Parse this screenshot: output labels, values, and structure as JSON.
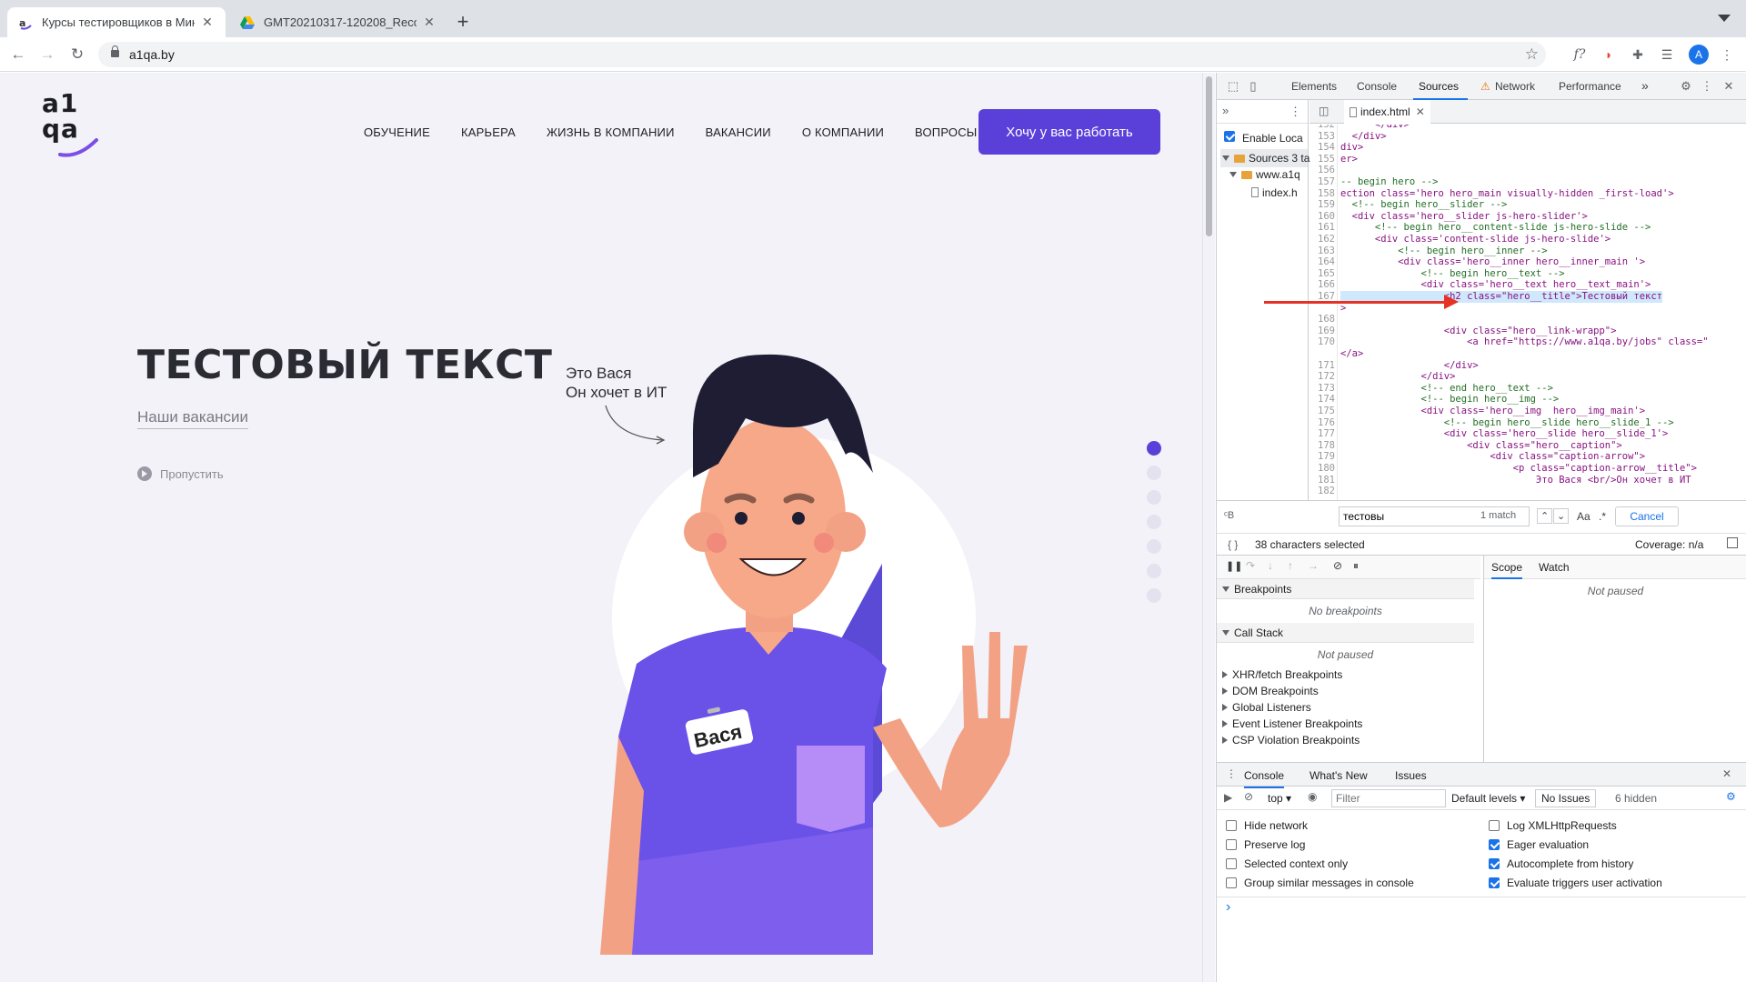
{
  "browser": {
    "tabs": [
      {
        "title": "Курсы тестировщиков в Мин",
        "active": true,
        "icon": "a1qa-favicon"
      },
      {
        "title": "GMT20210317-120208_Recor",
        "active": false,
        "icon": "google-drive-icon"
      }
    ],
    "new_tab": "+",
    "url": "a1qa.by",
    "avatar_letter": "A",
    "accent": "#1a73e8"
  },
  "site": {
    "logo_line1": "a1",
    "logo_line2": "qa",
    "nav": [
      "ОБУЧЕНИЕ",
      "КАРЬЕРА",
      "ЖИЗНЬ В КОМПАНИИ",
      "ВАКАНСИИ",
      "О КОМПАНИИ",
      "ВОПРОСЫ"
    ],
    "cta": "Хочу у вас работать",
    "hero_title": "ТЕСТОВЫЙ ТЕКСТ",
    "vacancies_link": "Наши вакансии",
    "skip": "Пропустить",
    "caption_line1": "Это Вася",
    "caption_line2": "Он хочет в ИТ",
    "badge_name": "Вася",
    "brand_color": "#5b3fd9"
  },
  "devtools": {
    "tabs": [
      "Elements",
      "Console",
      "Sources",
      "Network",
      "Performance"
    ],
    "active_tab": "Sources",
    "more": "»",
    "navigator": {
      "enable_local": "Enable Loca",
      "sources_label": "Sources 3 ta",
      "domain": "www.a1q",
      "file": "index.h"
    },
    "open_file": "index.html",
    "code_lines": [
      {
        "n": "152",
        "t": "      </div>"
      },
      {
        "n": "153",
        "t": "  </div>"
      },
      {
        "n": "154",
        "t": "div>"
      },
      {
        "n": "155",
        "t": "er>"
      },
      {
        "n": "156",
        "t": ""
      },
      {
        "n": "157",
        "t": "-- begin hero -->"
      },
      {
        "n": "158",
        "t": "ection class='hero hero_main visually-hidden _first-load'>"
      },
      {
        "n": "159",
        "t": "  <!-- begin hero__slider -->"
      },
      {
        "n": "160",
        "t": "  <div class='hero__slider js-hero-slider'>"
      },
      {
        "n": "161",
        "t": "      <!-- begin hero__content-slide js-hero-slide -->"
      },
      {
        "n": "162",
        "t": "      <div class='content-slide js-hero-slide'>"
      },
      {
        "n": "163",
        "t": "          <!-- begin hero__inner -->"
      },
      {
        "n": "164",
        "t": "          <div class='hero__inner hero__inner_main '>"
      },
      {
        "n": "165",
        "t": "              <!-- begin hero__text -->"
      },
      {
        "n": "166",
        "t": "              <div class='hero__text hero__text_main'>"
      },
      {
        "n": "167",
        "t": "                  <h2 class=\"hero__title\">Тестовый текст"
      },
      {
        "n": "",
        "t": ">"
      },
      {
        "n": "168",
        "t": ""
      },
      {
        "n": "169",
        "t": "                  <div class=\"hero__link-wrapp\">"
      },
      {
        "n": "170",
        "t": "                      <a href=\"https://www.a1qa.by/jobs\" class=\""
      },
      {
        "n": "",
        "t": "</a>"
      },
      {
        "n": "171",
        "t": "                  </div>"
      },
      {
        "n": "172",
        "t": "              </div>"
      },
      {
        "n": "173",
        "t": "              <!-- end hero__text -->"
      },
      {
        "n": "174",
        "t": "              <!-- begin hero__img -->"
      },
      {
        "n": "175",
        "t": "              <div class='hero__img  hero__img_main'>"
      },
      {
        "n": "176",
        "t": "                  <!-- begin hero__slide hero__slide_1 -->"
      },
      {
        "n": "177",
        "t": "                  <div class='hero__slide hero__slide_1'>"
      },
      {
        "n": "178",
        "t": "                      <div class=\"hero__caption\">"
      },
      {
        "n": "179",
        "t": "                          <div class=\"caption-arrow\">"
      },
      {
        "n": "180",
        "t": "                              <p class=\"caption-arrow__title\">"
      },
      {
        "n": "181",
        "t": "                                  Это Вася <br/>Он хочет в ИТ"
      },
      {
        "n": "182",
        "t": ""
      }
    ],
    "search": {
      "value": "тестовы",
      "matches": "1 match",
      "case_label": "Aa",
      "regex_label": ".*",
      "cancel": "Cancel"
    },
    "status": {
      "selection": "38 characters selected",
      "coverage": "Coverage: n/a"
    },
    "debugger": {
      "breakpoints": "Breakpoints",
      "no_breakpoints": "No breakpoints",
      "call_stack": "Call Stack",
      "not_paused": "Not paused",
      "sections": [
        "XHR/fetch Breakpoints",
        "DOM Breakpoints",
        "Global Listeners",
        "Event Listener Breakpoints",
        "CSP Violation Breakpoints"
      ],
      "scope": "Scope",
      "watch": "Watch",
      "scope_not_paused": "Not paused"
    },
    "drawer": {
      "tabs": [
        "Console",
        "What's New",
        "Issues"
      ],
      "context": "top",
      "filter_placeholder": "Filter",
      "levels": "Default levels",
      "issues": "No Issues",
      "hidden": "6 hidden",
      "options_left": [
        {
          "label": "Hide network",
          "checked": false
        },
        {
          "label": "Preserve log",
          "checked": false
        },
        {
          "label": "Selected context only",
          "checked": false
        },
        {
          "label": "Group similar messages in console",
          "checked": false
        }
      ],
      "options_right": [
        {
          "label": "Log XMLHttpRequests",
          "checked": false
        },
        {
          "label": "Eager evaluation",
          "checked": true
        },
        {
          "label": "Autocomplete from history",
          "checked": true
        },
        {
          "label": "Evaluate triggers user activation",
          "checked": true
        }
      ],
      "prompt": "›"
    }
  }
}
